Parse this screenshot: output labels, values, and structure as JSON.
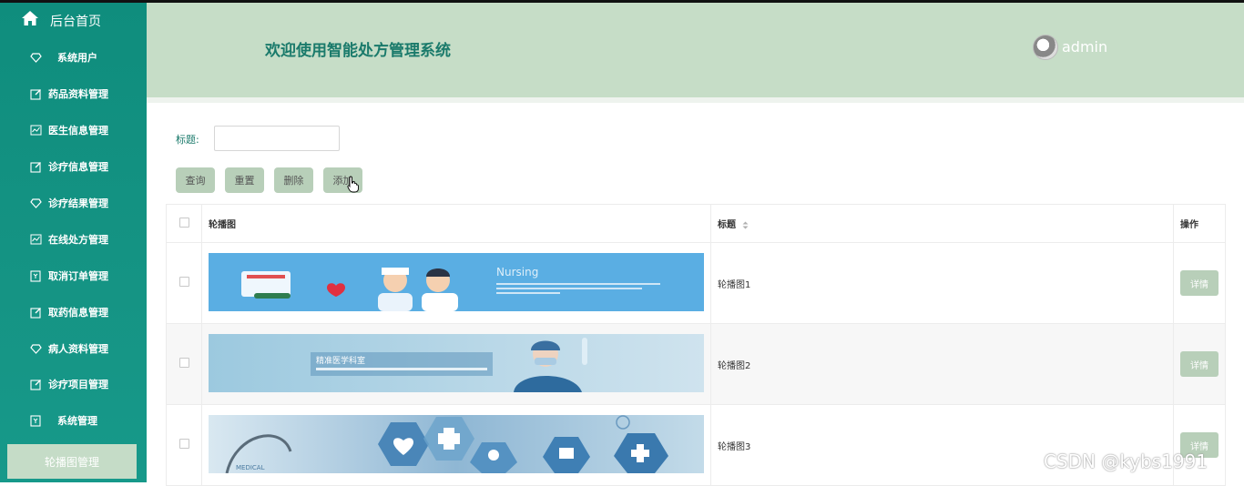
{
  "sidebar": {
    "home_label": "后台首页",
    "items": [
      {
        "label": "系统用户",
        "icon": "diamond-icon",
        "center": true
      },
      {
        "label": "药品资料管理",
        "icon": "edit-icon"
      },
      {
        "label": "医生信息管理",
        "icon": "chart-icon"
      },
      {
        "label": "诊疗信息管理",
        "icon": "edit-icon"
      },
      {
        "label": "诊疗结果管理",
        "icon": "diamond-icon"
      },
      {
        "label": "在线处方管理",
        "icon": "chart-icon"
      },
      {
        "label": "取消订单管理",
        "icon": "bookmark-icon"
      },
      {
        "label": "取药信息管理",
        "icon": "edit-icon"
      },
      {
        "label": "病人资料管理",
        "icon": "diamond-icon"
      },
      {
        "label": "诊疗项目管理",
        "icon": "edit-icon"
      },
      {
        "label": "系统管理",
        "icon": "bookmark-icon",
        "center": true
      }
    ],
    "active_label": "轮播图管理"
  },
  "header": {
    "title": "欢迎使用智能处方管理系统",
    "username": "admin"
  },
  "search": {
    "label": "标题:",
    "value": "",
    "placeholder": ""
  },
  "toolbar": {
    "query": "查询",
    "reset": "重置",
    "delete": "删除",
    "add": "添加"
  },
  "table": {
    "headers": [
      "轮播图",
      "标题",
      "操作"
    ],
    "rows": [
      {
        "title": "轮播图1",
        "action": "详情",
        "banner_text": "Nursing"
      },
      {
        "title": "轮播图2",
        "action": "详情",
        "banner_text": "精准医学科室"
      },
      {
        "title": "轮播图3",
        "action": "详情",
        "banner_text": "MEDICAL"
      }
    ]
  },
  "watermark": "CSDN @kybs1991",
  "colors": {
    "sidebar": "#119080",
    "header": "#c6ddc7",
    "button": "#b8cfb9",
    "title_text": "#1a7a6b"
  }
}
